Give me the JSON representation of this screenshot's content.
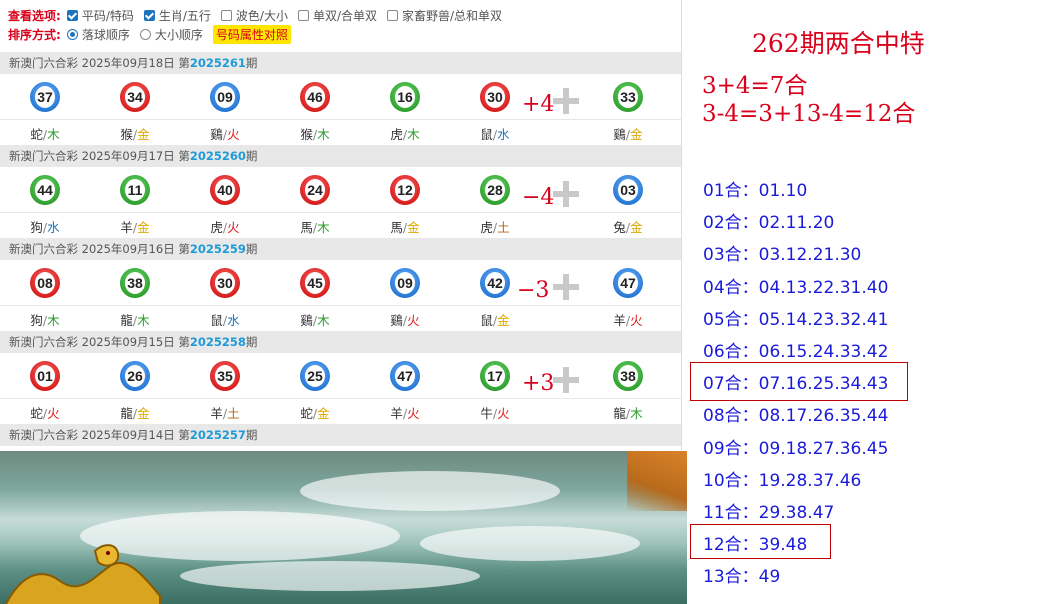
{
  "options": {
    "view_label": "查看选项:",
    "view_items": [
      {
        "label": "平码/特码",
        "checked": true
      },
      {
        "label": "生肖/五行",
        "checked": true
      },
      {
        "label": "波色/大小",
        "checked": false
      },
      {
        "label": "单双/合单双",
        "checked": false
      },
      {
        "label": "家畜野兽/总和单双",
        "checked": false
      }
    ],
    "sort_label": "排序方式:",
    "sort_items": [
      {
        "label": "落球顺序",
        "checked": true
      },
      {
        "label": "大小顺序",
        "checked": false
      }
    ],
    "compare_button": "号码属性对照"
  },
  "draws": [
    {
      "prefix": "新澳门六合彩 2025年09月18日 第",
      "period": "2025261",
      "suffix": "期",
      "delta": "+4",
      "balls": [
        {
          "num": "37",
          "color": "blue",
          "zodiac": "蛇",
          "element": "木"
        },
        {
          "num": "34",
          "color": "red",
          "zodiac": "猴",
          "element": "金"
        },
        {
          "num": "09",
          "color": "blue",
          "zodiac": "鷄",
          "element": "火"
        },
        {
          "num": "46",
          "color": "red",
          "zodiac": "猴",
          "element": "木"
        },
        {
          "num": "16",
          "color": "green",
          "zodiac": "虎",
          "element": "木"
        },
        {
          "num": "30",
          "color": "red",
          "zodiac": "鼠",
          "element": "水"
        },
        {
          "num": "33",
          "color": "green",
          "zodiac": "鷄",
          "element": "金"
        }
      ]
    },
    {
      "prefix": "新澳门六合彩 2025年09月17日 第",
      "period": "2025260",
      "suffix": "期",
      "delta": "−4",
      "balls": [
        {
          "num": "44",
          "color": "green",
          "zodiac": "狗",
          "element": "水"
        },
        {
          "num": "11",
          "color": "green",
          "zodiac": "羊",
          "element": "金"
        },
        {
          "num": "40",
          "color": "red",
          "zodiac": "虎",
          "element": "火"
        },
        {
          "num": "24",
          "color": "red",
          "zodiac": "馬",
          "element": "木"
        },
        {
          "num": "12",
          "color": "red",
          "zodiac": "馬",
          "element": "金"
        },
        {
          "num": "28",
          "color": "green",
          "zodiac": "虎",
          "element": "土"
        },
        {
          "num": "03",
          "color": "blue",
          "zodiac": "兔",
          "element": "金"
        }
      ]
    },
    {
      "prefix": "新澳门六合彩 2025年09月16日 第",
      "period": "2025259",
      "suffix": "期",
      "delta": "−3",
      "balls": [
        {
          "num": "08",
          "color": "red",
          "zodiac": "狗",
          "element": "木"
        },
        {
          "num": "38",
          "color": "green",
          "zodiac": "龍",
          "element": "木"
        },
        {
          "num": "30",
          "color": "red",
          "zodiac": "鼠",
          "element": "水"
        },
        {
          "num": "45",
          "color": "red",
          "zodiac": "鷄",
          "element": "木"
        },
        {
          "num": "09",
          "color": "blue",
          "zodiac": "鷄",
          "element": "火"
        },
        {
          "num": "42",
          "color": "blue",
          "zodiac": "鼠",
          "element": "金"
        },
        {
          "num": "47",
          "color": "blue",
          "zodiac": "羊",
          "element": "火"
        }
      ]
    },
    {
      "prefix": "新澳门六合彩 2025年09月15日 第",
      "period": "2025258",
      "suffix": "期",
      "delta": "+3",
      "balls": [
        {
          "num": "01",
          "color": "red",
          "zodiac": "蛇",
          "element": "火"
        },
        {
          "num": "26",
          "color": "blue",
          "zodiac": "龍",
          "element": "金"
        },
        {
          "num": "35",
          "color": "red",
          "zodiac": "羊",
          "element": "土"
        },
        {
          "num": "25",
          "color": "blue",
          "zodiac": "蛇",
          "element": "金"
        },
        {
          "num": "47",
          "color": "blue",
          "zodiac": "羊",
          "element": "火"
        },
        {
          "num": "17",
          "color": "green",
          "zodiac": "牛",
          "element": "火"
        },
        {
          "num": "38",
          "color": "green",
          "zodiac": "龍",
          "element": "木"
        }
      ]
    },
    {
      "prefix": "新澳门六合彩 2025年09月14日 第",
      "period": "2025257",
      "suffix": "期",
      "delta": "",
      "balls": []
    }
  ],
  "element_colors": {
    "木": "#2e9e2e",
    "金": "#e0a800",
    "火": "#e02020",
    "水": "#1e73be",
    "土": "#b5651d"
  },
  "right_panel": {
    "title": "262期两合中特",
    "line1": "3+4=7合",
    "line2": "3-4=3+13-4=12合",
    "groups": [
      "01合：01.10",
      "02合：02.11.20",
      "03合：03.12.21.30",
      "04合：04.13.22.31.40",
      "05合：05.14.23.32.41",
      "06合：06.15.24.33.42",
      "07合：07.16.25.34.43",
      "08合：08.17.26.35.44",
      "09合：09.18.27.36.45",
      "10合：19.28.37.46",
      "11合：29.38.47",
      "12合：39.48",
      "13合：49"
    ],
    "highlighted": [
      6,
      11
    ]
  }
}
